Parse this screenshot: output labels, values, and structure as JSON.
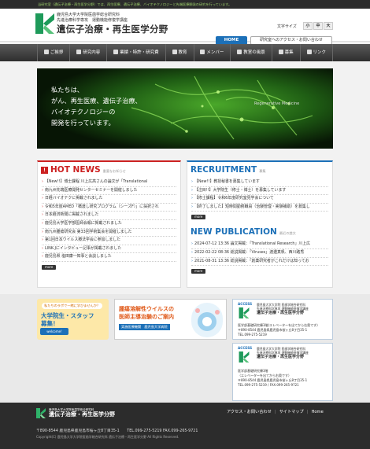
{
  "topstrip": "当研究室（遺伝子治療・再生医学分野）では、再生医療、遺伝子治療、バイオテクノロジーと先端医療開発の研究を行っています。",
  "header": {
    "sub1": "鹿児島大学大学院医歯学総合研究科",
    "sub2": "先進治療科学専攻　運動機能修復学講座",
    "title": "遺伝子治療・再生医学分野",
    "fontsize_label": "文字サイズ",
    "fontsize_options": [
      "小",
      "中",
      "大"
    ],
    "home": "HOME",
    "access": "研究室へのアクセス・お問い合わせ"
  },
  "nav": [
    "ご挨拶",
    "研究内容",
    "業績・特許・研究費",
    "教育",
    "メンバー",
    "教室の風景",
    "募集",
    "リンク"
  ],
  "hero": {
    "line1": "私たちは、",
    "line2": "がん、再生医療、遺伝子治療、",
    "line3": "バイオテクノロジーの",
    "line4": "開発を行っています。",
    "en": "Regenerative Medicine"
  },
  "hotnews": {
    "title": "HOT NEWS",
    "sub": "重要なお知らせ",
    "items": [
      "【New!!】博士課程 川上広高さんの論文が「Translational",
      "南九州先端医療開発センターセミナーを開催しました",
      "日経バイオテクに掲載されました",
      "令和5年度AMED「橋渡し研究プログラム（シーズF）」に採択され",
      "日本経済新聞に掲載されました",
      "鹿児島大学医学部医師会報に掲載されました",
      "南九州腫瘍研究会 第33回学術集会を開催しました",
      "第1回日本ウイルス療法学会に参加しました",
      "LINK-Jにインタビュー記事が掲載されました",
      "鹿児島県 塩田康一知事と会談しました"
    ],
    "more": "more"
  },
  "recruit": {
    "title": "RECRUITMENT",
    "sub": "募集",
    "items": [
      "【New!!】教授秘書を募集しています",
      "【注目!!】大学院生（修士・博士）を募集しています",
      "【修士課程】令和6年度研究室見学会について",
      "【終了しました】短時間勤務職員（治験管理・実験補助）を募集し"
    ],
    "more": "more"
  },
  "publication": {
    "title": "NEW PUBLICATION",
    "sub": "最近の論文",
    "items": [
      "2024-07-12 13:36 論文掲載：「Translational Research」川上広",
      "2022-02-22 08:36 総説掲載：「Viruses」渡邉真帆、西川路秀",
      "2021-08-31 13:36 総説掲載：「創薬研究者がこれだけは知ってお"
    ],
    "more": "more"
  },
  "banners": {
    "bn1_top": "私たちのラボで一緒に学びませんか？",
    "bn1_main1": "大学院生・スタッフ",
    "bn1_main2": "募集！",
    "bn1_bottom": "welcome!",
    "bn2_line1": "腫瘍溶解性ウイルスの",
    "bn2_line2": "医師主導治験のご案内",
    "bn2_tag": "実施医療機関　鹿児島大学病院",
    "ac1_label": "ACCESS",
    "ac1_name_s1": "鹿児島大学大学院 医歯学総合研究科",
    "ac1_name_s2": "先進治療科学専攻 運動機能修復学講座",
    "ac1_name_m": "遺伝子治療・再生医学分野",
    "ac1_addr1": "医学部基礎研究棟3階(エレベーターを出てから右奥です)",
    "ac1_addr2": "〒890-8544 鹿児島県鹿児島市桜ヶ丘8丁目35-1",
    "ac1_addr3": "TEL.099-275-5219",
    "ac2_label": "ACCESS",
    "ac2_name_s1": "鹿児島大学大学院 医歯学総合研究科",
    "ac2_name_s2": "先進治療科学専攻 運動機能修復学講座",
    "ac2_name_m": "遺伝子治療・再生医学分野",
    "ac2_addr1": "医学部基礎研究棟3階",
    "ac2_addr2": "（エレベーターを出てから右奥です）",
    "ac2_addr3": "〒890-8544 鹿児島県鹿児島市桜ヶ丘8丁目35-1",
    "ac2_addr4": "TEL.099-275-5219 / FAX.099-265-9721"
  },
  "footer": {
    "name_s": "鹿児島大学大学院医歯学総合研究科",
    "name_m": "遺伝子治療・再生医学分野",
    "links": [
      "アクセス・お問い合わせ",
      "サイトマップ",
      "Home"
    ],
    "addr": "〒890-8544 鹿児島県鹿児島市桜ヶ丘8丁目35-1　　TEL.099-275-5219 FAX.099-265-9721",
    "copy": "Copyright(C) 鹿児島大学大学院医歯学総合研究科 遺伝子治療・再生医学分野 All Rights Reserved."
  },
  "colors": {
    "brand_green": "#1e9a5a",
    "accent_blue": "#1c70b8",
    "hot_red": "#cc2222"
  }
}
